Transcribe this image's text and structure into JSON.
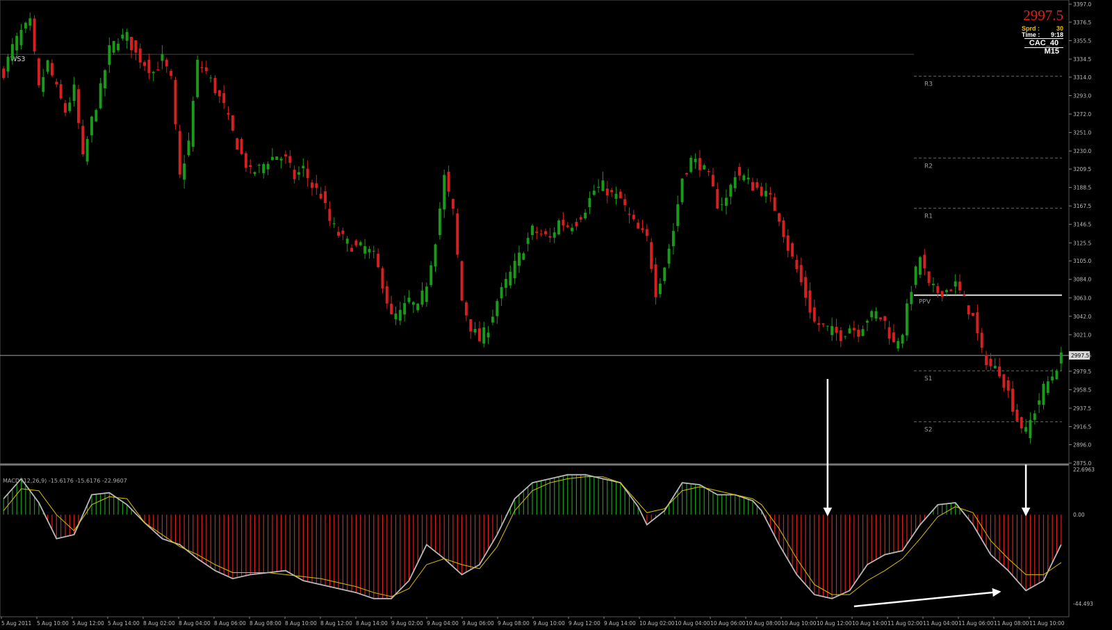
{
  "info_panel": {
    "price": "2997.5",
    "spread_label": "Sprd :",
    "spread_value": "30",
    "time_label": "Time :",
    "time_value": "9:18",
    "symbol": "CAC_40",
    "timeframe": "M15"
  },
  "macd_label": "MACD (12,26,9) -15.6176 -15.6176 -22.9607",
  "colors": {
    "background": "#000000",
    "bull": "#1a9a1a",
    "bear": "#d42020",
    "signal": "#e0c000",
    "macd_line": "#b8b8b8",
    "pivot_line": "#ffffff",
    "axis_text": "#bbbbbb"
  },
  "chart_data": [
    {
      "type": "candlestick",
      "title": "",
      "symbol": "CAC_40",
      "timeframe": "M15",
      "ylim": [
        2875,
        3397
      ],
      "current_price": 2997.5,
      "y_ticks": [
        "3397.0",
        "3376.5",
        "3355.5",
        "3334.5",
        "3314.0",
        "3293.0",
        "3272.0",
        "3251.0",
        "3230.0",
        "3209.5",
        "3188.5",
        "3167.5",
        "3146.5",
        "3125.5",
        "3105.0",
        "3084.0",
        "3063.0",
        "3042.0",
        "3021.0",
        "2997.5",
        "2979.5",
        "2958.5",
        "2937.5",
        "2916.5",
        "2896.0",
        "2875.0"
      ],
      "x_ticks": [
        "5 Aug 2011",
        "5 Aug 10:00",
        "5 Aug 12:00",
        "5 Aug 14:00",
        "8 Aug 02:00",
        "8 Aug 04:00",
        "8 Aug 06:00",
        "8 Aug 08:00",
        "8 Aug 10:00",
        "8 Aug 12:00",
        "8 Aug 14:00",
        "9 Aug 02:00",
        "9 Aug 04:00",
        "9 Aug 06:00",
        "9 Aug 08:00",
        "9 Aug 10:00",
        "9 Aug 12:00",
        "9 Aug 14:00",
        "10 Aug 02:00",
        "10 Aug 04:00",
        "10 Aug 06:00",
        "10 Aug 08:00",
        "10 Aug 10:00",
        "10 Aug 12:00",
        "10 Aug 14:00",
        "11 Aug 02:00",
        "11 Aug 04:00",
        "11 Aug 06:00",
        "11 Aug 08:00",
        "11 Aug 10:00"
      ],
      "pivot_levels": [
        {
          "name": "WS3",
          "value": 3340
        },
        {
          "name": "R3",
          "value": 3315
        },
        {
          "name": "R2",
          "value": 3222
        },
        {
          "name": "R1",
          "value": 3165
        },
        {
          "name": "PPV",
          "value": 3066
        },
        {
          "name": "S1",
          "value": 2980
        },
        {
          "name": "S2",
          "value": 2922
        }
      ],
      "close_path": [
        [
          0,
          3320
        ],
        [
          2,
          3348
        ],
        [
          4,
          3365
        ],
        [
          6,
          3375
        ],
        [
          8,
          3300
        ],
        [
          10,
          3330
        ],
        [
          12,
          3300
        ],
        [
          14,
          3275
        ],
        [
          16,
          3300
        ],
        [
          18,
          3220
        ],
        [
          20,
          3265
        ],
        [
          22,
          3300
        ],
        [
          24,
          3345
        ],
        [
          26,
          3358
        ],
        [
          28,
          3360
        ],
        [
          30,
          3340
        ],
        [
          32,
          3330
        ],
        [
          34,
          3320
        ],
        [
          36,
          3335
        ],
        [
          38,
          3310
        ],
        [
          40,
          3200
        ],
        [
          42,
          3240
        ],
        [
          44,
          3330
        ],
        [
          46,
          3320
        ],
        [
          48,
          3300
        ],
        [
          50,
          3280
        ],
        [
          52,
          3250
        ],
        [
          54,
          3225
        ],
        [
          56,
          3205
        ],
        [
          58,
          3210
        ],
        [
          60,
          3220
        ],
        [
          62,
          3225
        ],
        [
          64,
          3220
        ],
        [
          66,
          3200
        ],
        [
          68,
          3210
        ],
        [
          70,
          3190
        ],
        [
          72,
          3180
        ],
        [
          74,
          3150
        ],
        [
          76,
          3135
        ],
        [
          78,
          3125
        ],
        [
          80,
          3120
        ],
        [
          82,
          3120
        ],
        [
          84,
          3110
        ],
        [
          86,
          3080
        ],
        [
          88,
          3040
        ],
        [
          90,
          3045
        ],
        [
          92,
          3060
        ],
        [
          94,
          3050
        ],
        [
          96,
          3080
        ],
        [
          98,
          3130
        ],
        [
          100,
          3200
        ],
        [
          102,
          3160
        ],
        [
          104,
          3060
        ],
        [
          106,
          3030
        ],
        [
          108,
          3015
        ],
        [
          110,
          3030
        ],
        [
          112,
          3060
        ],
        [
          114,
          3080
        ],
        [
          116,
          3100
        ],
        [
          118,
          3120
        ],
        [
          120,
          3140
        ],
        [
          122,
          3135
        ],
        [
          124,
          3130
        ],
        [
          126,
          3150
        ],
        [
          128,
          3145
        ],
        [
          130,
          3150
        ],
        [
          132,
          3165
        ],
        [
          134,
          3185
        ],
        [
          136,
          3190
        ],
        [
          138,
          3180
        ],
        [
          140,
          3175
        ],
        [
          142,
          3155
        ],
        [
          144,
          3140
        ],
        [
          146,
          3130
        ],
        [
          148,
          3070
        ],
        [
          150,
          3100
        ],
        [
          152,
          3140
        ],
        [
          154,
          3200
        ],
        [
          156,
          3220
        ],
        [
          158,
          3215
        ],
        [
          160,
          3200
        ],
        [
          162,
          3170
        ],
        [
          164,
          3175
        ],
        [
          166,
          3205
        ],
        [
          168,
          3200
        ],
        [
          170,
          3190
        ],
        [
          172,
          3185
        ],
        [
          174,
          3175
        ],
        [
          176,
          3155
        ],
        [
          178,
          3120
        ],
        [
          180,
          3095
        ],
        [
          182,
          3065
        ],
        [
          184,
          3035
        ],
        [
          186,
          3030
        ],
        [
          188,
          3025
        ],
        [
          190,
          3020
        ],
        [
          192,
          3030
        ],
        [
          194,
          3025
        ],
        [
          196,
          3040
        ],
        [
          198,
          3045
        ],
        [
          200,
          3035
        ],
        [
          202,
          3010
        ],
        [
          204,
          3025
        ],
        [
          206,
          3075
        ],
        [
          208,
          3110
        ],
        [
          210,
          3075
        ],
        [
          212,
          3070
        ],
        [
          214,
          3072
        ],
        [
          216,
          3078
        ],
        [
          218,
          3060
        ],
        [
          220,
          3040
        ],
        [
          222,
          3000
        ],
        [
          224,
          2985
        ],
        [
          226,
          2980
        ],
        [
          228,
          2955
        ],
        [
          230,
          2925
        ],
        [
          232,
          2910
        ],
        [
          234,
          2935
        ],
        [
          236,
          2960
        ],
        [
          238,
          2975
        ],
        [
          240,
          2995
        ]
      ]
    },
    {
      "type": "macd",
      "title": "MACD (12,26,9)",
      "params": [
        12,
        26,
        9
      ],
      "values": {
        "main": -15.6176,
        "macd": -15.6176,
        "signal": -22.9607
      },
      "ylim": [
        -44.493,
        22.6963
      ],
      "y_ticks": [
        "22.6963",
        "0.00",
        "-44.493"
      ],
      "macd_path": [
        [
          0,
          8
        ],
        [
          4,
          18
        ],
        [
          8,
          6
        ],
        [
          12,
          -12
        ],
        [
          16,
          -10
        ],
        [
          20,
          10
        ],
        [
          24,
          11
        ],
        [
          28,
          5
        ],
        [
          32,
          -4
        ],
        [
          36,
          -12
        ],
        [
          40,
          -15
        ],
        [
          44,
          -22
        ],
        [
          48,
          -28
        ],
        [
          52,
          -32
        ],
        [
          56,
          -30
        ],
        [
          60,
          -29
        ],
        [
          64,
          -28
        ],
        [
          68,
          -33
        ],
        [
          72,
          -35
        ],
        [
          76,
          -37
        ],
        [
          80,
          -39
        ],
        [
          84,
          -42
        ],
        [
          88,
          -42
        ],
        [
          92,
          -33
        ],
        [
          96,
          -15
        ],
        [
          100,
          -22
        ],
        [
          104,
          -30
        ],
        [
          108,
          -25
        ],
        [
          112,
          -10
        ],
        [
          116,
          8
        ],
        [
          120,
          16
        ],
        [
          124,
          18
        ],
        [
          128,
          20
        ],
        [
          132,
          20
        ],
        [
          136,
          18
        ],
        [
          140,
          16
        ],
        [
          144,
          4
        ],
        [
          146,
          -5
        ],
        [
          150,
          2
        ],
        [
          154,
          16
        ],
        [
          158,
          15
        ],
        [
          162,
          10
        ],
        [
          166,
          10
        ],
        [
          170,
          7
        ],
        [
          172,
          2
        ],
        [
          176,
          -15
        ],
        [
          180,
          -30
        ],
        [
          184,
          -40
        ],
        [
          188,
          -42
        ],
        [
          192,
          -38
        ],
        [
          196,
          -25
        ],
        [
          200,
          -20
        ],
        [
          204,
          -18
        ],
        [
          208,
          -5
        ],
        [
          212,
          5
        ],
        [
          216,
          6
        ],
        [
          220,
          -5
        ],
        [
          224,
          -20
        ],
        [
          228,
          -28
        ],
        [
          232,
          -38
        ],
        [
          236,
          -33
        ],
        [
          240,
          -15
        ]
      ],
      "signal_path": [
        [
          0,
          2
        ],
        [
          4,
          13
        ],
        [
          8,
          12
        ],
        [
          12,
          0
        ],
        [
          16,
          -8
        ],
        [
          20,
          5
        ],
        [
          24,
          9
        ],
        [
          28,
          8
        ],
        [
          32,
          -4
        ],
        [
          36,
          -10
        ],
        [
          40,
          -16
        ],
        [
          44,
          -20
        ],
        [
          48,
          -25
        ],
        [
          52,
          -29
        ],
        [
          56,
          -29
        ],
        [
          60,
          -29
        ],
        [
          64,
          -30
        ],
        [
          68,
          -31
        ],
        [
          72,
          -32
        ],
        [
          76,
          -34
        ],
        [
          80,
          -36
        ],
        [
          84,
          -39
        ],
        [
          88,
          -41
        ],
        [
          92,
          -37
        ],
        [
          96,
          -25
        ],
        [
          100,
          -22
        ],
        [
          104,
          -25
        ],
        [
          108,
          -27
        ],
        [
          112,
          -16
        ],
        [
          116,
          2
        ],
        [
          120,
          12
        ],
        [
          124,
          16
        ],
        [
          128,
          18
        ],
        [
          132,
          19
        ],
        [
          136,
          19
        ],
        [
          140,
          16
        ],
        [
          144,
          6
        ],
        [
          146,
          1
        ],
        [
          150,
          3
        ],
        [
          154,
          12
        ],
        [
          158,
          14
        ],
        [
          162,
          12
        ],
        [
          166,
          10
        ],
        [
          170,
          8
        ],
        [
          172,
          5
        ],
        [
          176,
          -7
        ],
        [
          180,
          -22
        ],
        [
          184,
          -35
        ],
        [
          188,
          -40
        ],
        [
          192,
          -40
        ],
        [
          196,
          -33
        ],
        [
          200,
          -28
        ],
        [
          204,
          -22
        ],
        [
          208,
          -12
        ],
        [
          212,
          -1
        ],
        [
          216,
          4
        ],
        [
          220,
          1
        ],
        [
          224,
          -13
        ],
        [
          228,
          -22
        ],
        [
          232,
          -30
        ],
        [
          236,
          -30
        ],
        [
          240,
          -24
        ]
      ],
      "annotations": [
        {
          "type": "arrow",
          "description": "divergence line between MACD lows"
        }
      ]
    }
  ]
}
